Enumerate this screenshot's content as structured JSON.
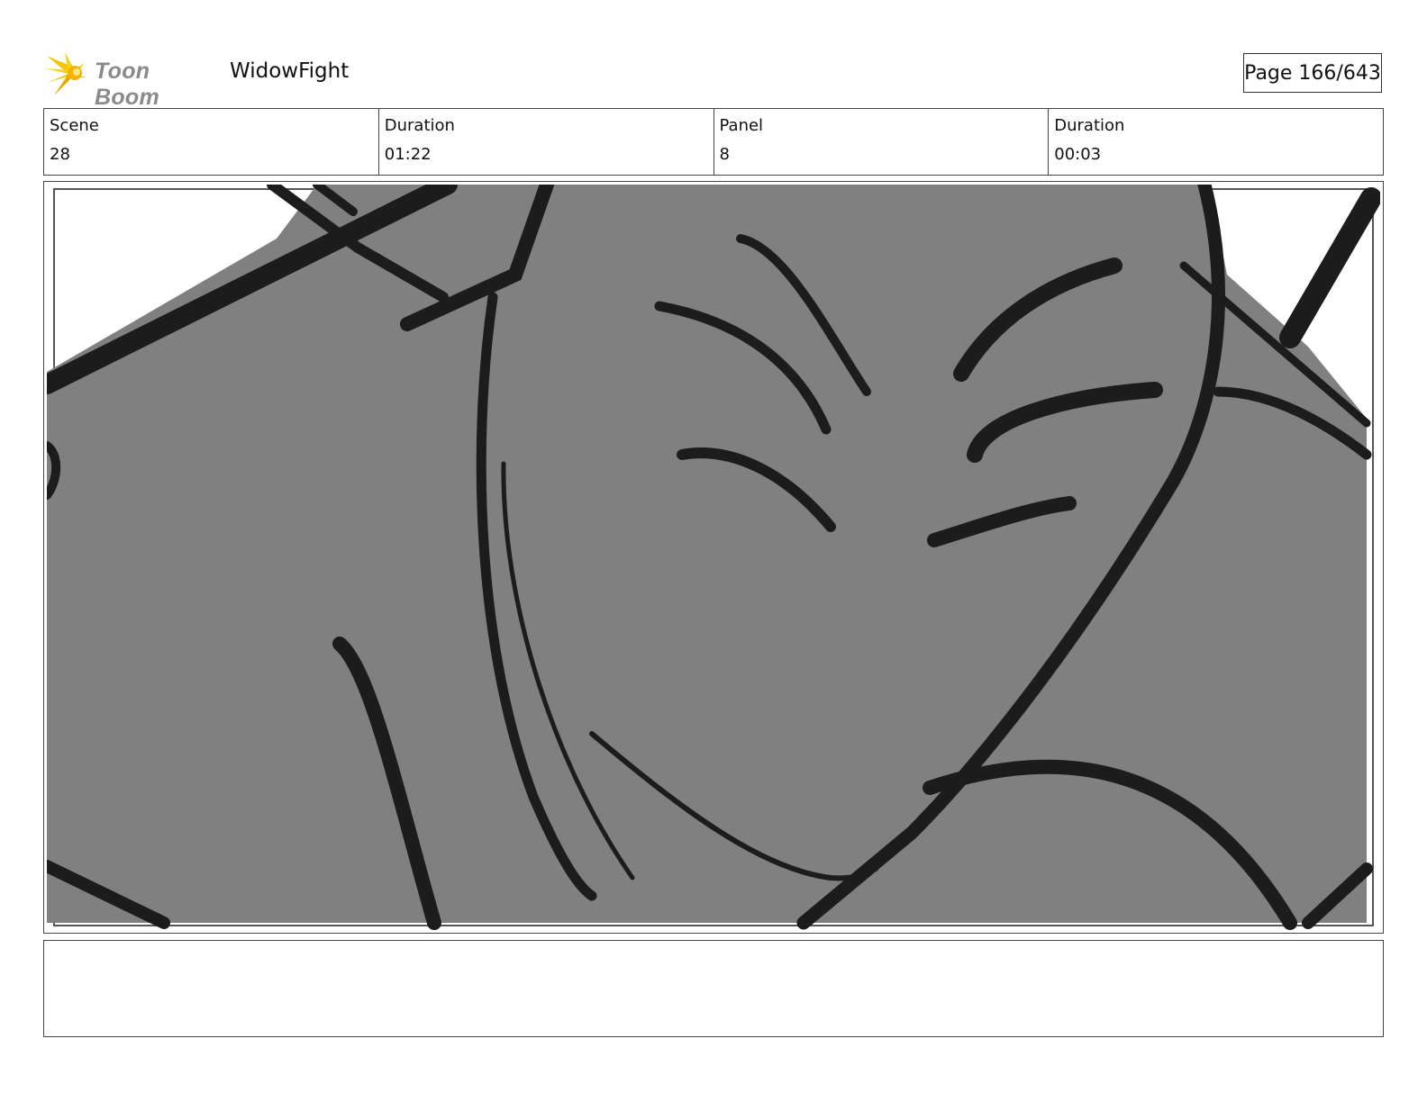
{
  "header": {
    "logo_text": "Toon Boom",
    "project_title": "WidowFight",
    "page_indicator": "Page 166/643"
  },
  "info": {
    "scene_label": "Scene",
    "scene_value": "28",
    "scene_duration_label": "Duration",
    "scene_duration_value": "01:22",
    "panel_label": "Panel",
    "panel_value": "8",
    "panel_duration_label": "Duration",
    "panel_duration_value": "00:03"
  },
  "panel": {
    "fill_color": "#808080",
    "ink_color": "#1c1c1c"
  },
  "notes": {
    "text": ""
  }
}
